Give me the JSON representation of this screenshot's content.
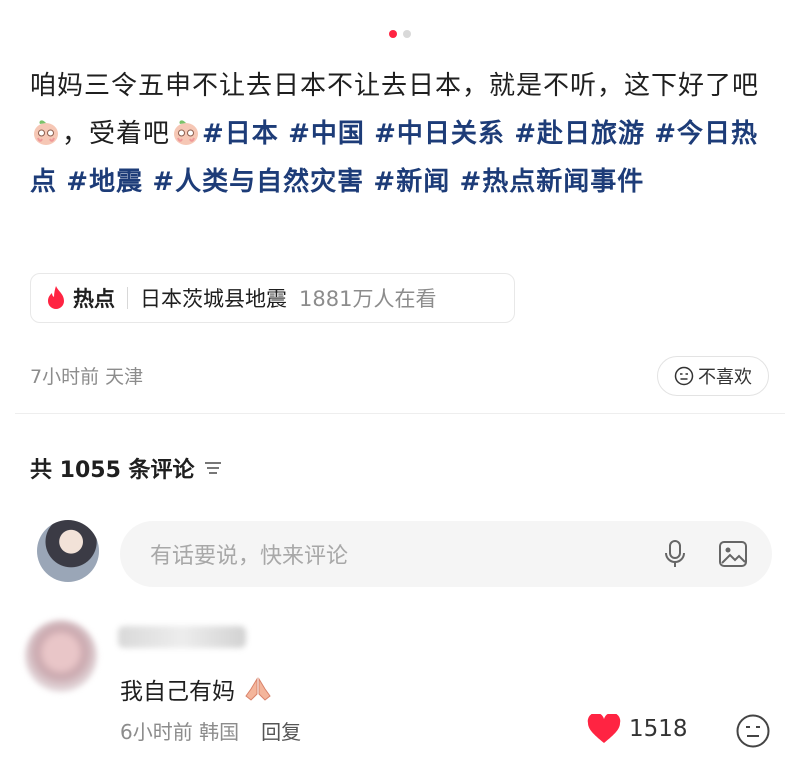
{
  "carousel": {
    "count": 2,
    "active": 0
  },
  "post": {
    "text_a": "咱妈三令五申不让去日本不让去日本，就是不听，这下好了吧",
    "emoji_1": "peach-face",
    "text_b": "，受着吧",
    "emoji_2": "peach-face",
    "tags": [
      "#日本",
      "#中国",
      "#中日关系",
      "#赴日旅游",
      "#今日热点",
      "#地震",
      "#人类与自然灾害",
      "#新闻",
      "#热点新闻事件"
    ]
  },
  "hot": {
    "label": "热点",
    "topic": "日本茨城县地震",
    "views": "1881万人在看",
    "icon": "flame-icon"
  },
  "meta": {
    "time_location": "7小时前 天津",
    "dislike_label": "不喜欢"
  },
  "comments": {
    "header": "共 1055 条评论",
    "input_placeholder": "有话要说，快来评论",
    "items": [
      {
        "text": "我自己有妈",
        "emoji": "praying-hands",
        "time": "6小时前",
        "location": "韩国",
        "reply_label": "回复",
        "likes": "1518"
      }
    ]
  },
  "colors": {
    "accent": "#ff2442",
    "tag": "#1d3c78",
    "muted": "#8c8c8c"
  }
}
